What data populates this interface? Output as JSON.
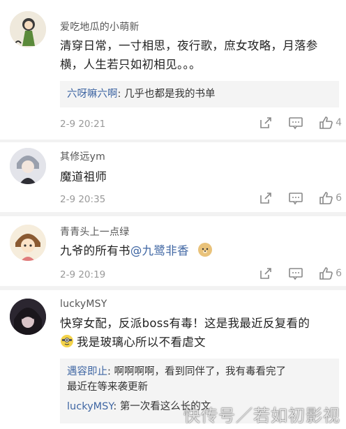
{
  "comments": [
    {
      "username": "爱吃地瓜的小萌新",
      "text_line1": "清穿日常，一寸相思，夜行歌，庶女攻略，月落参",
      "text_line2": "横，人生若只如初相见。。。",
      "reply": {
        "name": "六呀嘛六啊",
        "text": "几乎也都是我的书单"
      },
      "time": "2-9 20:21",
      "likes": "4"
    },
    {
      "username": "其修远ym",
      "text": "魔道祖师",
      "time": "2-9 20:35",
      "likes": "6"
    },
    {
      "username": "青青头上一点绿",
      "text_prefix": "九爷的所有书",
      "mention": "@九鹭非香",
      "time": "2-9 20:19",
      "likes": "6"
    },
    {
      "username": "luckyMSY",
      "text_line1": "快穿女配，反派boss有毒！这是我最近反复看的",
      "text_line2": "我是玻璃心所以不看虐文",
      "reply1": {
        "name": "遇容即止",
        "line1": "啊啊啊啊，看到同伴了，我有毒看完了",
        "line2": "最近在等来袭更新"
      },
      "reply2": {
        "name": "luckyMSY",
        "text": "第一次看这么长的文"
      }
    }
  ],
  "watermark": "快传号／若如初影视",
  "icons": {
    "share": "share-icon",
    "comment": "comment-icon",
    "like": "like-icon"
  },
  "colors": {
    "link_blue": "#3f66a3",
    "meta_gray": "#999999",
    "reply_bg": "#f4f4f4"
  }
}
